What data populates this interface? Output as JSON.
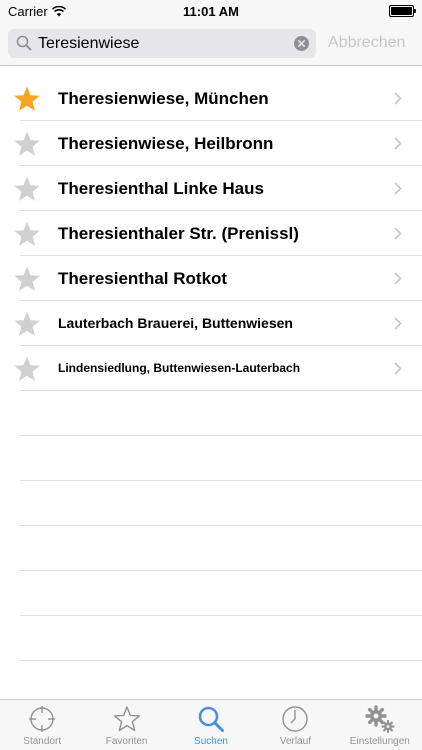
{
  "status_bar": {
    "carrier": "Carrier",
    "time": "11:01 AM"
  },
  "search": {
    "value": "Teresienwiese",
    "cancel_label": "Abbrechen"
  },
  "results": [
    {
      "label": "Theresienwiese, München",
      "favorite": true,
      "size": "lg"
    },
    {
      "label": "Theresienwiese, Heilbronn",
      "favorite": false,
      "size": "lg"
    },
    {
      "label": "Theresienthal Linke Haus",
      "favorite": false,
      "size": "lg"
    },
    {
      "label": "Theresienthaler Str. (Prenissl)",
      "favorite": false,
      "size": "lg"
    },
    {
      "label": "Theresienthal Rotkot",
      "favorite": false,
      "size": "lg"
    },
    {
      "label": "Lauterbach Brauerei, Buttenwiesen",
      "favorite": false,
      "size": "md"
    },
    {
      "label": "Lindensiedlung, Buttenwiesen-Lauterbach",
      "favorite": false,
      "size": "sm"
    }
  ],
  "tabs": [
    {
      "label": "Standort",
      "icon": "crosshair-icon",
      "active": false
    },
    {
      "label": "Favoriten",
      "icon": "star-icon",
      "active": false
    },
    {
      "label": "Suchen",
      "icon": "search-icon",
      "active": true
    },
    {
      "label": "Verlauf",
      "icon": "clock-icon",
      "active": false
    },
    {
      "label": "Einstellungen",
      "icon": "gear-icon",
      "active": false
    }
  ],
  "colors": {
    "favorite_star": "#f6a623",
    "inactive_star": "#d0d0d0",
    "active_tab": "#4a90d9",
    "inactive_tab": "#929292"
  }
}
